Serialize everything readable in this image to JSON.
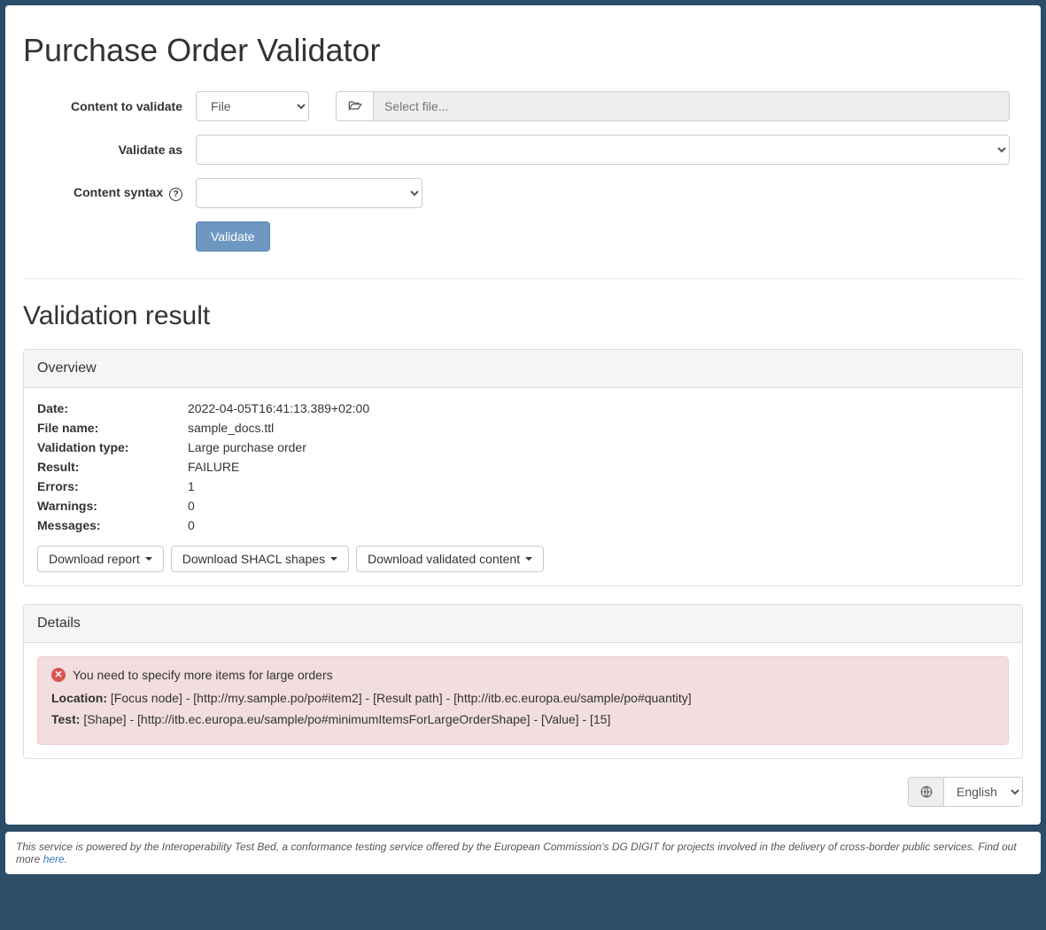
{
  "title": "Purchase Order Validator",
  "form": {
    "content_to_validate_label": "Content to validate",
    "content_to_validate_value": "File",
    "file_placeholder": "Select file...",
    "validate_as_label": "Validate as",
    "content_syntax_label": "Content syntax",
    "validate_button": "Validate"
  },
  "result": {
    "heading": "Validation result",
    "overview_title": "Overview",
    "rows": {
      "date_label": "Date:",
      "date_value": "2022-04-05T16:41:13.389+02:00",
      "filename_label": "File name:",
      "filename_value": "sample_docs.ttl",
      "type_label": "Validation type:",
      "type_value": "Large purchase order",
      "result_label": "Result:",
      "result_value": "FAILURE",
      "errors_label": "Errors:",
      "errors_value": "1",
      "warnings_label": "Warnings:",
      "warnings_value": "0",
      "messages_label": "Messages:",
      "messages_value": "0"
    },
    "downloads": {
      "report": "Download report",
      "shapes": "Download SHACL shapes",
      "content": "Download validated content"
    },
    "details_title": "Details",
    "error": {
      "message": "You need to specify more items for large orders",
      "location_label": "Location:",
      "location_value": "[Focus node] - [http://my.sample.po/po#item2] - [Result path] - [http://itb.ec.europa.eu/sample/po#quantity]",
      "test_label": "Test:",
      "test_value": "[Shape] - [http://itb.ec.europa.eu/sample/po#minimumItemsForLargeOrderShape] - [Value] - [15]"
    }
  },
  "lang": {
    "value": "English"
  },
  "footer": {
    "text": "This service is powered by the Interoperability Test Bed, a conformance testing service offered by the European Commission's DG DIGIT for projects involved in the delivery of cross-border public services. Find out more ",
    "link": "here",
    "suffix": "."
  }
}
